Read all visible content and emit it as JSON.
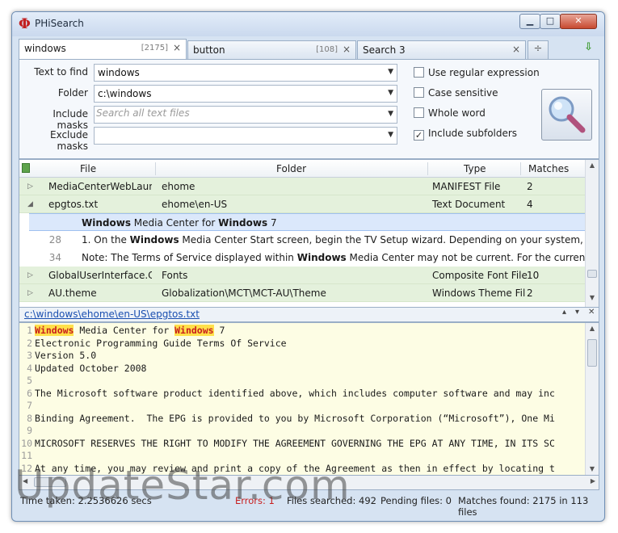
{
  "window": {
    "title": "PHiSearch"
  },
  "tabs": [
    {
      "label": "windows",
      "count": "[2175]",
      "close": "×"
    },
    {
      "label": "button",
      "count": "[108]",
      "close": "×"
    },
    {
      "label": "Search 3",
      "count": "",
      "close": "×"
    }
  ],
  "tab_add": "÷",
  "search": {
    "text_label": "Text to find",
    "text_value": "windows",
    "folder_label": "Folder",
    "folder_value": "c:\\windows",
    "include_label": "Include masks",
    "include_placeholder": "Search all text files",
    "exclude_label": "Exclude masks",
    "exclude_value": "",
    "options": {
      "regex": "Use regular expression",
      "case": "Case sensitive",
      "whole": "Whole word",
      "subfolders": "Include subfolders"
    }
  },
  "results": {
    "columns": [
      "File",
      "Folder",
      "Type",
      "Matches"
    ],
    "rows": [
      {
        "file": "MediaCenterWebLaunch",
        "folder": "ehome",
        "type": "MANIFEST File",
        "matches": "2"
      },
      {
        "file": "epgtos.txt",
        "folder": "ehome\\en-US",
        "type": "Text Document",
        "matches": "4"
      },
      {
        "file": "GlobalUserInterface.Con",
        "folder": "Fonts",
        "type": "Composite Font File",
        "matches": "10"
      },
      {
        "file": "AU.theme",
        "folder": "Globalization\\MCT\\MCT-AU\\Theme",
        "type": "Windows Theme File",
        "matches": "2"
      }
    ],
    "matches": [
      {
        "line": "1",
        "parts": [
          "",
          "Windows",
          " Media Center for ",
          "Windows",
          " 7"
        ]
      },
      {
        "line": "28",
        "parts": [
          "1. On the ",
          "Windows",
          " Media Center Start screen, begin the TV Setup wizard. Depending on your system, select T",
          "",
          ""
        ]
      },
      {
        "line": "34",
        "parts": [
          "Note: The Terms of Service displayed within ",
          "Windows",
          " Media Center may not be current. For the current version",
          "",
          ""
        ]
      }
    ]
  },
  "preview": {
    "path": "c:\\windows\\ehome\\en-US\\epgtos.txt",
    "lines": [
      {
        "n": "1",
        "pre": "",
        "hl1": "Windows",
        "mid": " Media Center for ",
        "hl2": "Windows",
        "post": " 7"
      },
      {
        "n": "2",
        "pre": "Electronic Programming Guide Terms Of Service",
        "hl1": "",
        "mid": "",
        "hl2": "",
        "post": ""
      },
      {
        "n": "3",
        "pre": "Version 5.0",
        "hl1": "",
        "mid": "",
        "hl2": "",
        "post": ""
      },
      {
        "n": "4",
        "pre": "Updated October 2008",
        "hl1": "",
        "mid": "",
        "hl2": "",
        "post": ""
      },
      {
        "n": "5",
        "pre": "",
        "hl1": "",
        "mid": "",
        "hl2": "",
        "post": ""
      },
      {
        "n": "6",
        "pre": "The Microsoft software product identified above, which includes computer software and may inc",
        "hl1": "",
        "mid": "",
        "hl2": "",
        "post": ""
      },
      {
        "n": "7",
        "pre": "",
        "hl1": "",
        "mid": "",
        "hl2": "",
        "post": ""
      },
      {
        "n": "8",
        "pre": "Binding Agreement.  The EPG is provided to you by Microsoft Corporation (“Microsoft”), One Mi",
        "hl1": "",
        "mid": "",
        "hl2": "",
        "post": ""
      },
      {
        "n": "9",
        "pre": "",
        "hl1": "",
        "mid": "",
        "hl2": "",
        "post": ""
      },
      {
        "n": "10",
        "pre": "MICROSOFT RESERVES THE RIGHT TO MODIFY THE AGREEMENT GOVERNING THE EPG AT ANY TIME, IN ITS SC",
        "hl1": "",
        "mid": "",
        "hl2": "",
        "post": ""
      },
      {
        "n": "11",
        "pre": "",
        "hl1": "",
        "mid": "",
        "hl2": "",
        "post": ""
      },
      {
        "n": "12",
        "pre": "At any time, you may review and print a copy of the Agreement as then in effect by locating t",
        "hl1": "",
        "mid": "",
        "hl2": "",
        "post": ""
      }
    ]
  },
  "status": {
    "time": "Time taken: 2.2536626 secs",
    "errors": "Errors: 1",
    "files": "Files searched: 492",
    "pending": "Pending files: 0",
    "matches": "Matches found: 2175 in 113 files"
  },
  "watermark": "UpdateStar.com"
}
